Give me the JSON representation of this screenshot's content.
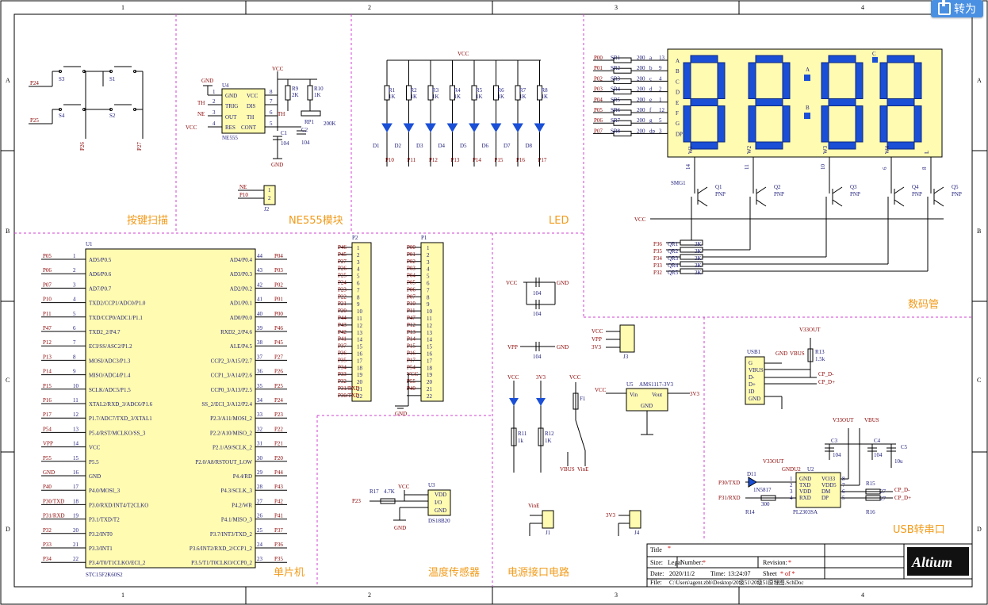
{
  "toolbar": {
    "translate_label": "转为"
  },
  "border": {
    "cols": [
      "1",
      "2",
      "3",
      "4"
    ],
    "rows": [
      "A",
      "B",
      "C",
      "D"
    ]
  },
  "sections": {
    "keys": "按键扫描",
    "ne555": "NE555模块",
    "led": "LED",
    "seg": "数码管",
    "mcu": "单片机",
    "temp": "温度传感器",
    "power": "电源接口电路",
    "usb": "USB转串口"
  },
  "keys": {
    "nets": [
      "P24",
      "P25",
      "P26",
      "P27"
    ],
    "switches": [
      "S3",
      "S1",
      "S4",
      "S2"
    ]
  },
  "ne555": {
    "ref": "U4",
    "part": "NE555",
    "pins_left": [
      "GND",
      "TRIG",
      "OUT",
      "RES"
    ],
    "pins_right": [
      "VCC",
      "DIS",
      "TH",
      "CONT"
    ],
    "pin_nums_left": [
      "1",
      "2",
      "3",
      "4"
    ],
    "pin_nums_right": [
      "8",
      "7",
      "6",
      "5"
    ],
    "nets": [
      "GND",
      "TH",
      "NE",
      "VCC",
      "VCC",
      "TH",
      "GND"
    ],
    "res": [
      "R9",
      "2K",
      "R10",
      "1K"
    ],
    "pot": [
      "RP1",
      "200K"
    ],
    "caps": [
      "C1",
      "104",
      "C2",
      "104"
    ],
    "j2": {
      "ref": "J2",
      "nets": [
        "NE",
        "P10"
      ],
      "pins": [
        "1",
        "2"
      ]
    }
  },
  "led": {
    "vcc": "VCC",
    "resistors": [
      "R1",
      "R2",
      "R3",
      "R4",
      "R5",
      "R6",
      "R7",
      "R8"
    ],
    "val": "1K",
    "leds": [
      "D1",
      "D2",
      "D3",
      "D4",
      "D5",
      "D6",
      "D7",
      "D8"
    ],
    "nets": [
      "P10",
      "P11",
      "P12",
      "P13",
      "P14",
      "P15",
      "P16",
      "P17"
    ]
  },
  "seg": {
    "nets": [
      "P00",
      "P01",
      "P02",
      "P03",
      "P04",
      "P05",
      "P06",
      "P07"
    ],
    "res": [
      "SR1",
      "SR2",
      "SR3",
      "SR4",
      "SR5",
      "SR6",
      "SR7",
      "SR8"
    ],
    "val": "200",
    "segs": [
      "a",
      "b",
      "c",
      "d",
      "e",
      "f",
      "g",
      "dp"
    ],
    "pins": [
      "13",
      "9",
      "4",
      "2",
      "1",
      "12",
      "5",
      "3"
    ],
    "letters": [
      "A",
      "B",
      "C",
      "D",
      "E",
      "F",
      "G",
      "DP"
    ],
    "digit_labels": [
      "A",
      "B",
      "C"
    ],
    "w": [
      "W1",
      "W2",
      "W3",
      "W4",
      "L"
    ],
    "wpins": [
      "14",
      "11",
      "10",
      "6",
      "8"
    ],
    "part": "SMG1",
    "q": [
      "Q1",
      "Q2",
      "Q3",
      "Q4",
      "Q5"
    ],
    "pnp": "PNP",
    "vcc": "VCC",
    "qnets": [
      "P36",
      "P35",
      "P34",
      "P33",
      "P32"
    ],
    "qr": [
      "QR1",
      "QR2",
      "QR3",
      "QR4",
      "QR5"
    ],
    "qval": "3K"
  },
  "mcu": {
    "ref": "U1",
    "part": "STC15F2K60S2",
    "left": [
      [
        "P05",
        "1",
        "AD5/P0.5"
      ],
      [
        "P06",
        "2",
        "AD6/P0.6"
      ],
      [
        "P07",
        "3",
        "AD7/P0.7"
      ],
      [
        "P10",
        "4",
        "TXD2/CCP1/ADC0/P1.0"
      ],
      [
        "P11",
        "5",
        "TXD/CCP0/ADC1/P1.1"
      ],
      [
        "P47",
        "6",
        "TXD2_2/P4.7"
      ],
      [
        "P12",
        "7",
        "ECI/SS/ASC2/P1.2"
      ],
      [
        "P13",
        "8",
        "MOSI/ADC3/P1.3"
      ],
      [
        "P14",
        "9",
        "MISO/ADC4/P1.4"
      ],
      [
        "P15",
        "10",
        "SCLK/ADC5/P1.5"
      ],
      [
        "P16",
        "11",
        "XTAL2/RXD_3/ADC6/P1.6"
      ],
      [
        "P17",
        "12",
        "P1.7/ADC7/TXD_3/XTAL1"
      ],
      [
        "P54",
        "13",
        "P5.4/RST/MCLKO/SS_3"
      ],
      [
        "VPP",
        "14",
        "VCC"
      ],
      [
        "P55",
        "15",
        "P5.5"
      ],
      [
        "GND",
        "16",
        "GND"
      ],
      [
        "P40",
        "17",
        "P4.0/MOSI_3"
      ],
      [
        "P30/TXD",
        "18",
        "P3.0/RXD/INT4/T2CLKO"
      ],
      [
        "P31/RXD",
        "19",
        "P3.1/TXD/T2"
      ],
      [
        "P32",
        "20",
        "P3.2/INT0"
      ],
      [
        "P33",
        "21",
        "P3.3/INT1"
      ],
      [
        "P34",
        "22",
        "P3.4/T0/T1CLKO/ECI_2"
      ]
    ],
    "right": [
      [
        "P04",
        "44",
        "AD4/P0.4"
      ],
      [
        "P03",
        "43",
        "AD3/P0.3"
      ],
      [
        "P02",
        "42",
        "AD2/P0.2"
      ],
      [
        "P01",
        "41",
        "AD1/P0.1"
      ],
      [
        "P00",
        "40",
        "AD0/P0.0"
      ],
      [
        "P46",
        "39",
        "RXD2_2/P4.6"
      ],
      [
        "P45",
        "38",
        "ALE/P4.5"
      ],
      [
        "P27",
        "37",
        "CCP2_3/A15/P2.7"
      ],
      [
        "P26",
        "36",
        "CCP1_3/A14/P2.6"
      ],
      [
        "P25",
        "35",
        "CCP0_3/A13/P2.5"
      ],
      [
        "P24",
        "34",
        "SS_2/ECI_3/A12/P2.4"
      ],
      [
        "P23",
        "33",
        "P2.3/A11/MOSI_2"
      ],
      [
        "P22",
        "32",
        "P2.2/A10/MISO_2"
      ],
      [
        "P21",
        "31",
        "P2.1/A9/SCLK_2"
      ],
      [
        "P20",
        "30",
        "P2.0/A8/RSTOUT_LOW"
      ],
      [
        "P44",
        "29",
        "P4.4/RD"
      ],
      [
        "P43",
        "28",
        "P4.3/SCLK_3"
      ],
      [
        "P42",
        "27",
        "P4.2/WR"
      ],
      [
        "P41",
        "26",
        "P4.1/MISO_3"
      ],
      [
        "P37",
        "25",
        "P3.7/INT3/TXD_2"
      ],
      [
        "P36",
        "24",
        "P3.6/INT2/RXD_2/CCP1_2"
      ],
      [
        "P35",
        "23",
        "P3.5/T1/T0CLKO/CCP0_2"
      ]
    ]
  },
  "p2": {
    "ref": "P2",
    "nets": [
      "P46",
      "P45",
      "P27",
      "P26",
      "P25",
      "P24",
      "P23",
      "P22",
      "P21",
      "P20",
      "P44",
      "P43",
      "P42",
      "P41",
      "P37",
      "P36",
      "P35",
      "P34",
      "P33",
      "P32",
      "P31/RXD",
      "P30/TXD"
    ]
  },
  "p1": {
    "ref": "P1",
    "nets": [
      "P00",
      "P01",
      "P02",
      "P03",
      "P04",
      "P05",
      "P06",
      "P07",
      "P10",
      "P11",
      "P47",
      "P12",
      "P13",
      "P14",
      "P15",
      "P16",
      "P17",
      "P54",
      "VCC",
      "P55",
      "P40",
      ""
    ]
  },
  "gnd": "GND",
  "temp": {
    "ref": "U3",
    "part": "DS18B20",
    "pins": [
      "VDD",
      "I/O",
      "GND"
    ],
    "res": "R17",
    "val": "4.7K",
    "net": "P23",
    "vcc": "VCC",
    "gnd": "GND"
  },
  "power": {
    "caps": [
      "104",
      "104",
      "104"
    ],
    "nets": [
      "VCC",
      "GND",
      "VPP",
      "GND"
    ],
    "j3": {
      "ref": "J3",
      "nets": [
        "VCC",
        "VPP",
        "3V3"
      ]
    },
    "leds": [
      "VCC",
      "3V3"
    ],
    "res": [
      "R11",
      "1k",
      "R12",
      "1K"
    ],
    "f1": "F1",
    "sw": [
      "VBUS",
      "VinE"
    ],
    "reg": {
      "ref": "U5",
      "part": "AMS1117-3V3",
      "pins": [
        "Vin",
        "Vout",
        "GND"
      ],
      "nets": [
        "VCC",
        "3V3"
      ]
    },
    "j1": {
      "ref": "J1",
      "net": "VinE"
    },
    "j4": {
      "ref": "J4",
      "net": "3V3"
    }
  },
  "usb": {
    "ref": "USB1",
    "pins": [
      "G",
      "VBUS",
      "D-",
      "D+",
      "ID",
      "GND"
    ],
    "nets": [
      "GND",
      "VBUS",
      "V33OUT",
      "R13",
      "1.5k",
      "CP_D-",
      "CP_D+"
    ],
    "u2": {
      "ref": "U2",
      "part": "PL2303SA",
      "left": [
        "GND",
        "TXD",
        "VDD",
        "RXD"
      ],
      "right": [
        "VO33",
        "VDD5",
        "DM",
        "DP"
      ],
      "lnums": [
        "1",
        "2",
        "3",
        "4"
      ],
      "rnums": [
        "8",
        "7",
        "6",
        "5"
      ]
    },
    "d11": [
      "D11",
      "1N5817"
    ],
    "r14": [
      "R14",
      "300"
    ],
    "r15": [
      "R15",
      "27"
    ],
    "r16": [
      "R16",
      "27"
    ],
    "caps": [
      "C3",
      "104",
      "C4",
      "104",
      "C5",
      "10u"
    ],
    "rx": [
      "P30/TXD",
      "P31/RXD"
    ],
    "vo": [
      "V33OUT",
      "V33OUT",
      "VBUS",
      "GNDU2"
    ]
  },
  "title_block": {
    "title": "Title",
    "title_val": "*",
    "size": "Size:",
    "size_val": "Legal",
    "number": "Number:",
    "number_val": "*",
    "revision": "Revision:",
    "revision_val": "*",
    "date": "Date:",
    "date_val": "2020/11/2",
    "time": "Time:",
    "time_val": "13:24:07",
    "sheet": "Sheet",
    "sheet_val": "* of *",
    "file": "File:",
    "file_val": "C:\\Users\\agent.zbb\\Desktop\\20级51\\20级51原理图.SchDoc",
    "logo": "Altium"
  }
}
